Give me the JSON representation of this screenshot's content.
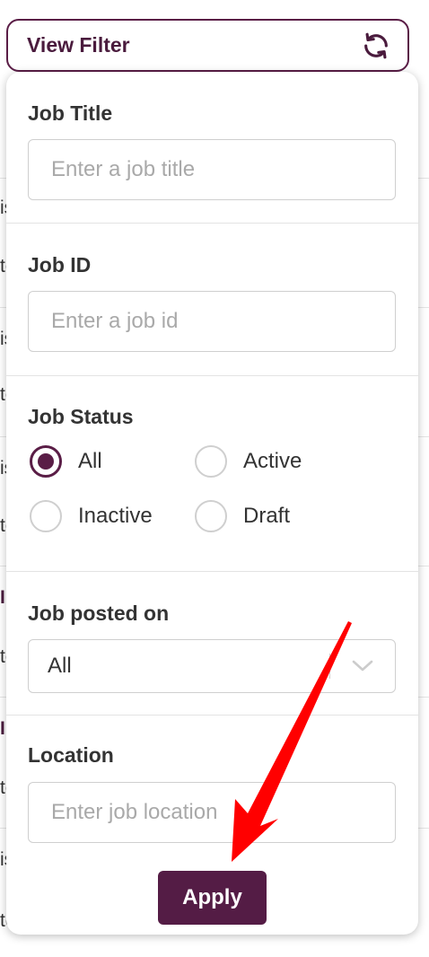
{
  "filter_toggle": {
    "label": "View Filter",
    "icon": "refresh-icon"
  },
  "background_list": {
    "chars": [
      "is",
      "to",
      "is",
      "to",
      "is",
      "to",
      "I",
      "to",
      "I",
      "to",
      "is",
      "te"
    ]
  },
  "filter": {
    "job_title": {
      "label": "Job Title",
      "value": "",
      "placeholder": "Enter a job title"
    },
    "job_id": {
      "label": "Job ID",
      "value": "",
      "placeholder": "Enter a job id"
    },
    "job_status": {
      "label": "Job Status",
      "options": [
        {
          "label": "All",
          "checked": true
        },
        {
          "label": "Active",
          "checked": false
        },
        {
          "label": "Inactive",
          "checked": false
        },
        {
          "label": "Draft",
          "checked": false
        }
      ]
    },
    "job_posted_on": {
      "label": "Job posted on",
      "selected": "All",
      "icon": "chevron-down-icon"
    },
    "location": {
      "label": "Location",
      "value": "",
      "placeholder": "Enter job location"
    },
    "apply_label": "Apply"
  },
  "colors": {
    "brand": "#541c45",
    "annotation_arrow": "#ff0000"
  }
}
